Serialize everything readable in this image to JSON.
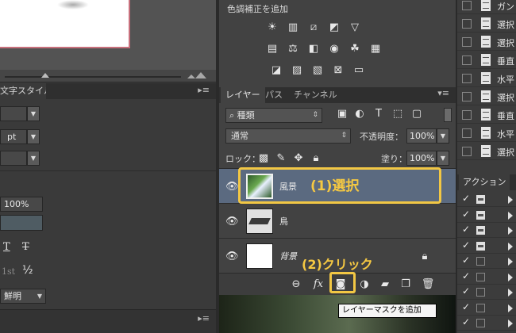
{
  "left_panel": {
    "character_tab": "文字スタイル",
    "font_size_value": "pt",
    "scale_value": "100%",
    "antialias_value": "鮮明"
  },
  "adjustments": {
    "title": "色調補正を追加"
  },
  "layers_panel": {
    "tabs": [
      "レイヤー",
      "パス",
      "チャンネル"
    ],
    "kind_label": "種類",
    "blend_mode": "通常",
    "opacity_label": "不透明度：",
    "opacity_value": "100%",
    "lock_label": "ロック：",
    "fill_label": "塗り：",
    "fill_value": "100%",
    "layers": [
      {
        "name": "風景",
        "selected": true
      },
      {
        "name": "鳥",
        "selected": false
      },
      {
        "name": "背景",
        "selected": false
      }
    ],
    "fx_label": "fx",
    "tooltip": "レイヤーマスクを追加"
  },
  "annotations": {
    "select": "(1)選択",
    "click": "(2)クリック",
    "color": "#f2c744"
  },
  "history_panel": {
    "items": [
      "ガン",
      "選択",
      "選択",
      "垂直",
      "水平",
      "選択",
      "垂直",
      "水平",
      "選択"
    ]
  },
  "actions_panel": {
    "title": "アクション",
    "rows": [
      {
        "checked": true,
        "dialog": true
      },
      {
        "checked": true,
        "dialog": true
      },
      {
        "checked": true,
        "dialog": true
      },
      {
        "checked": true,
        "dialog": true
      },
      {
        "checked": true,
        "dialog": false
      },
      {
        "checked": true,
        "dialog": false
      },
      {
        "checked": true,
        "dialog": false
      },
      {
        "checked": true,
        "dialog": false
      },
      {
        "checked": true,
        "dialog": false
      }
    ]
  }
}
